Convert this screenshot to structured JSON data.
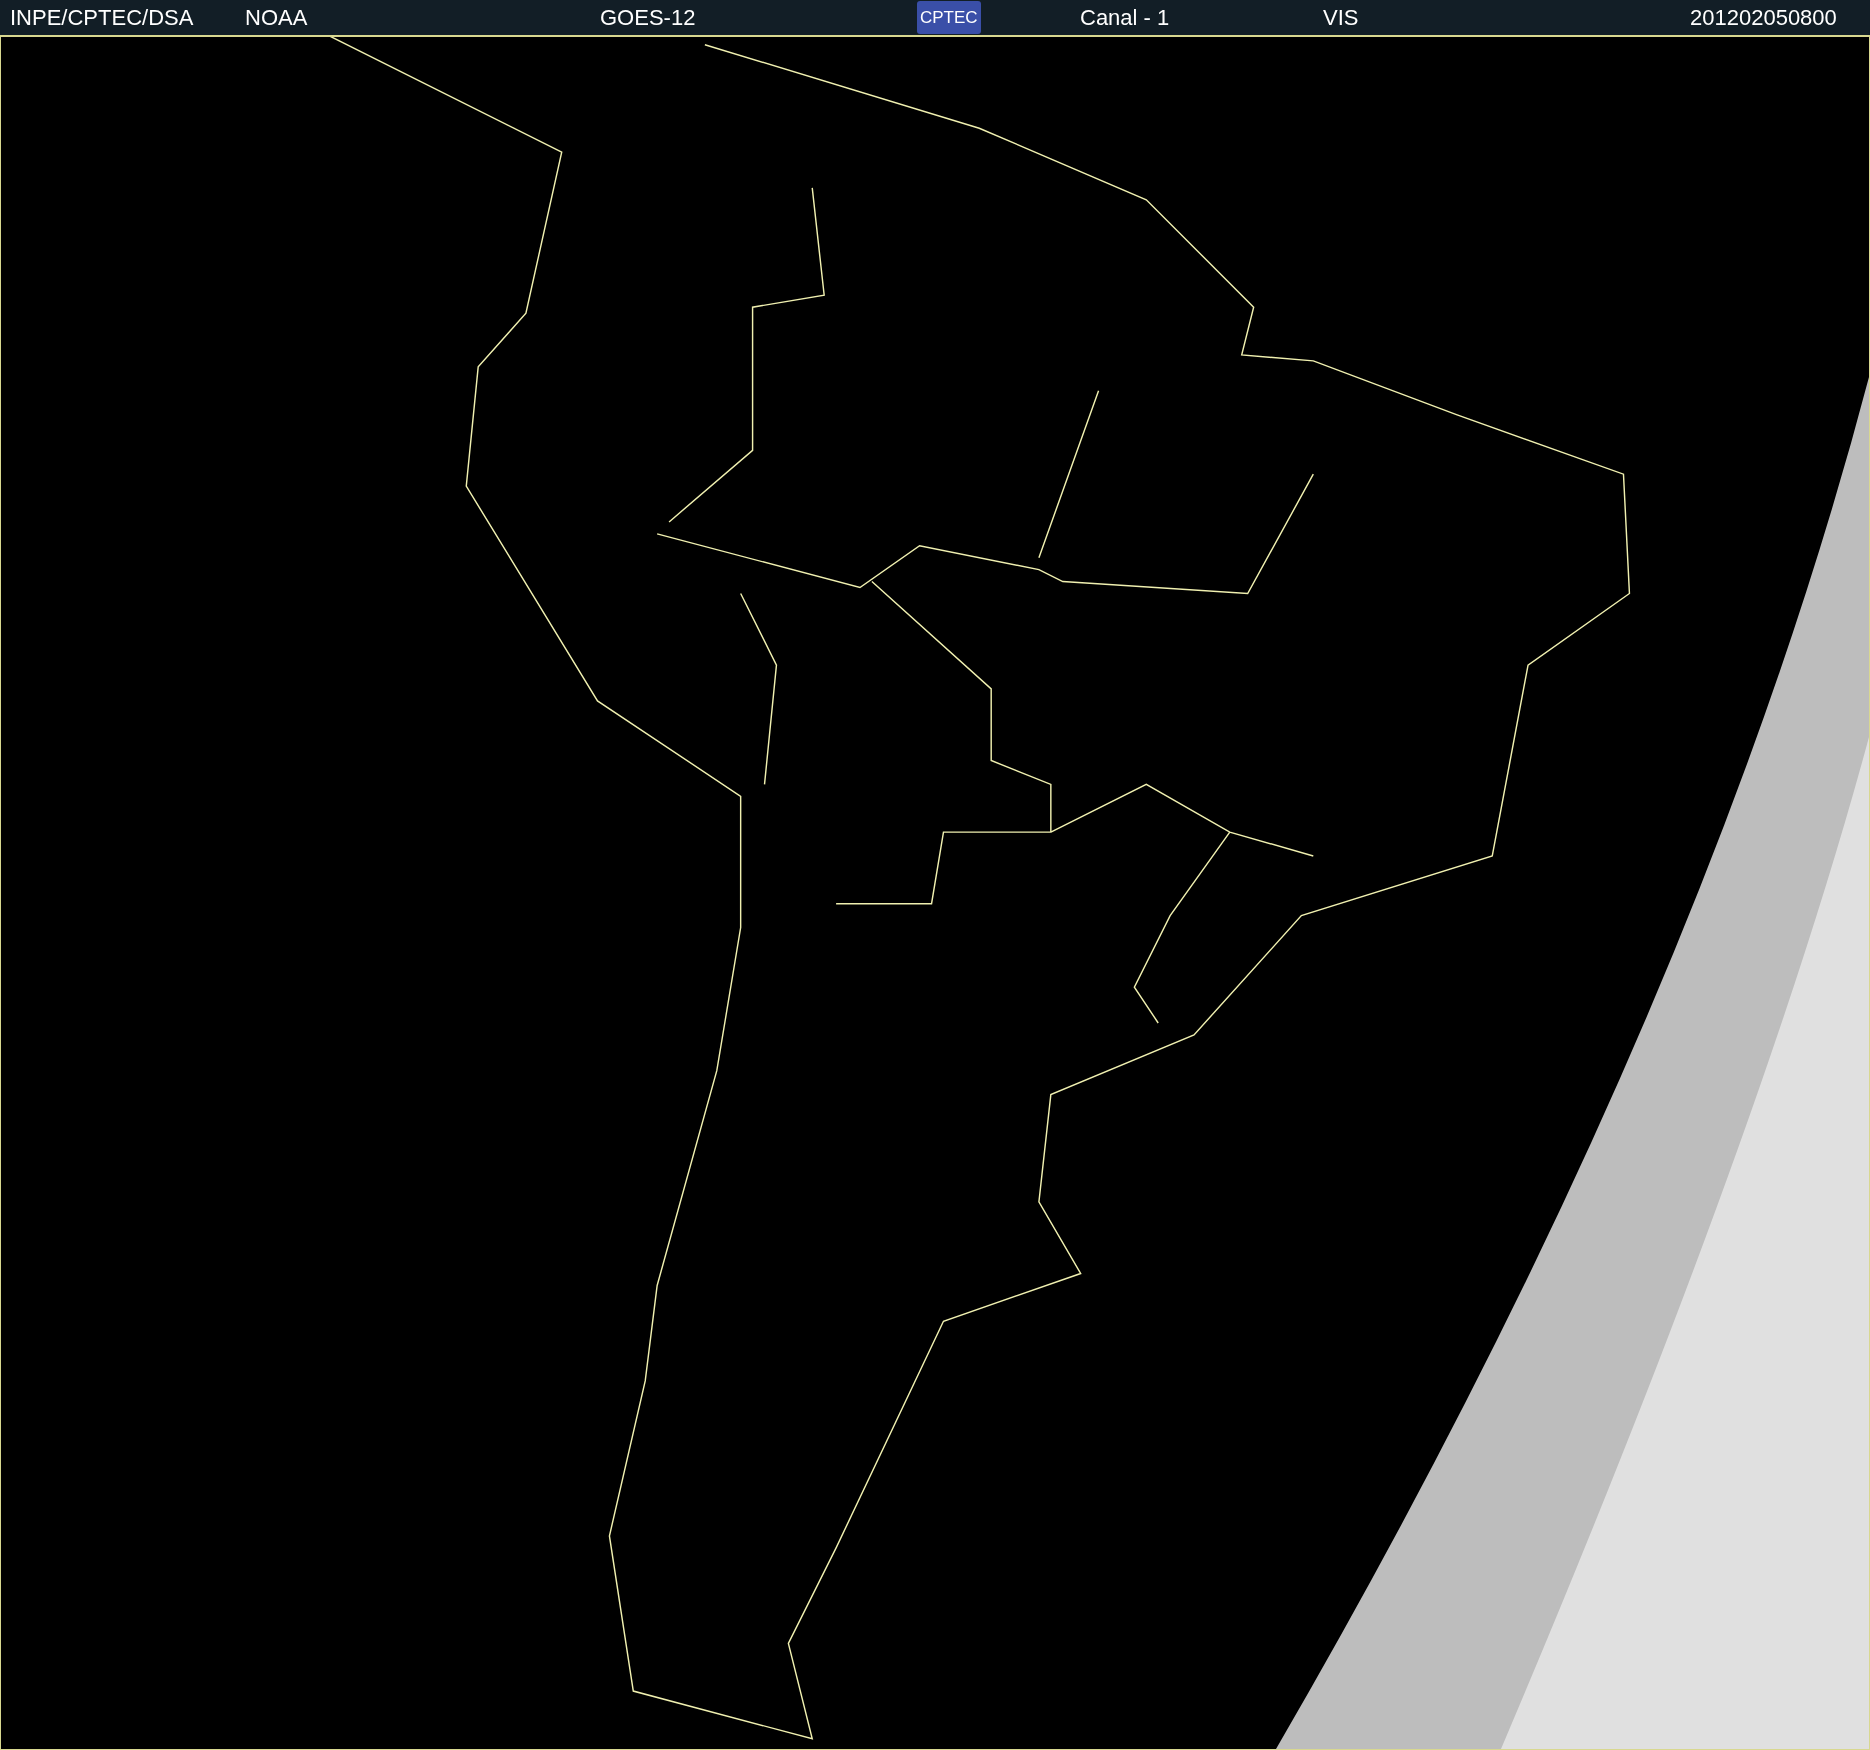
{
  "header": {
    "items": [
      {
        "kind": "text",
        "text": "INPE/CPTEC/DSA"
      },
      {
        "kind": "text",
        "text": "NOAA"
      },
      {
        "kind": "text",
        "text": "GOES-12"
      },
      {
        "kind": "logo",
        "text": "CPTEC"
      },
      {
        "kind": "text",
        "text": "Canal - 1"
      },
      {
        "kind": "text",
        "text": "VIS"
      },
      {
        "kind": "text",
        "text": "201202050800"
      }
    ]
  }
}
